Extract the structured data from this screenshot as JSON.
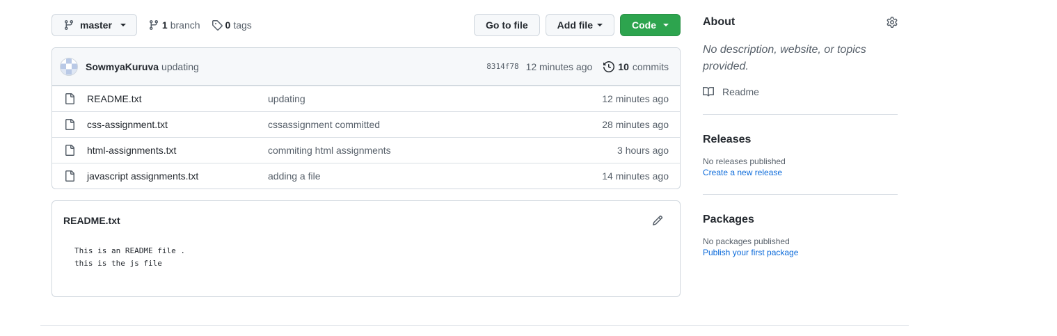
{
  "toolbar": {
    "branch_name": "master",
    "branch_count": "1",
    "branch_label": "branch",
    "tag_count": "0",
    "tag_label": "tags",
    "go_to_file": "Go to file",
    "add_file": "Add file",
    "code": "Code"
  },
  "commit": {
    "author": "SowmyaKuruva",
    "message": "updating",
    "sha": "8314f78",
    "time": "12 minutes ago",
    "count": "10",
    "count_label": "commits"
  },
  "files": [
    {
      "name": "README.txt",
      "message": "updating",
      "time": "12 minutes ago"
    },
    {
      "name": "css-assignment.txt",
      "message": "cssassignment committed",
      "time": "28 minutes ago"
    },
    {
      "name": "html-assignments.txt",
      "message": "commiting html assignments",
      "time": "3 hours ago"
    },
    {
      "name": "javascript assignments.txt",
      "message": "adding a file",
      "time": "14 minutes ago"
    }
  ],
  "readme": {
    "title": "README.txt",
    "content": "This is an README file .\nthis is the js file"
  },
  "sidebar": {
    "about_title": "About",
    "about_desc": "No description, website, or topics provided.",
    "readme_label": "Readme",
    "releases_title": "Releases",
    "releases_none": "No releases published",
    "releases_link": "Create a new release",
    "packages_title": "Packages",
    "packages_none": "No packages published",
    "packages_link": "Publish your first package"
  },
  "colors": {
    "primary_button": "#2da44e",
    "link": "#0969da",
    "muted_text": "#57606a",
    "border": "#d0d7de"
  }
}
